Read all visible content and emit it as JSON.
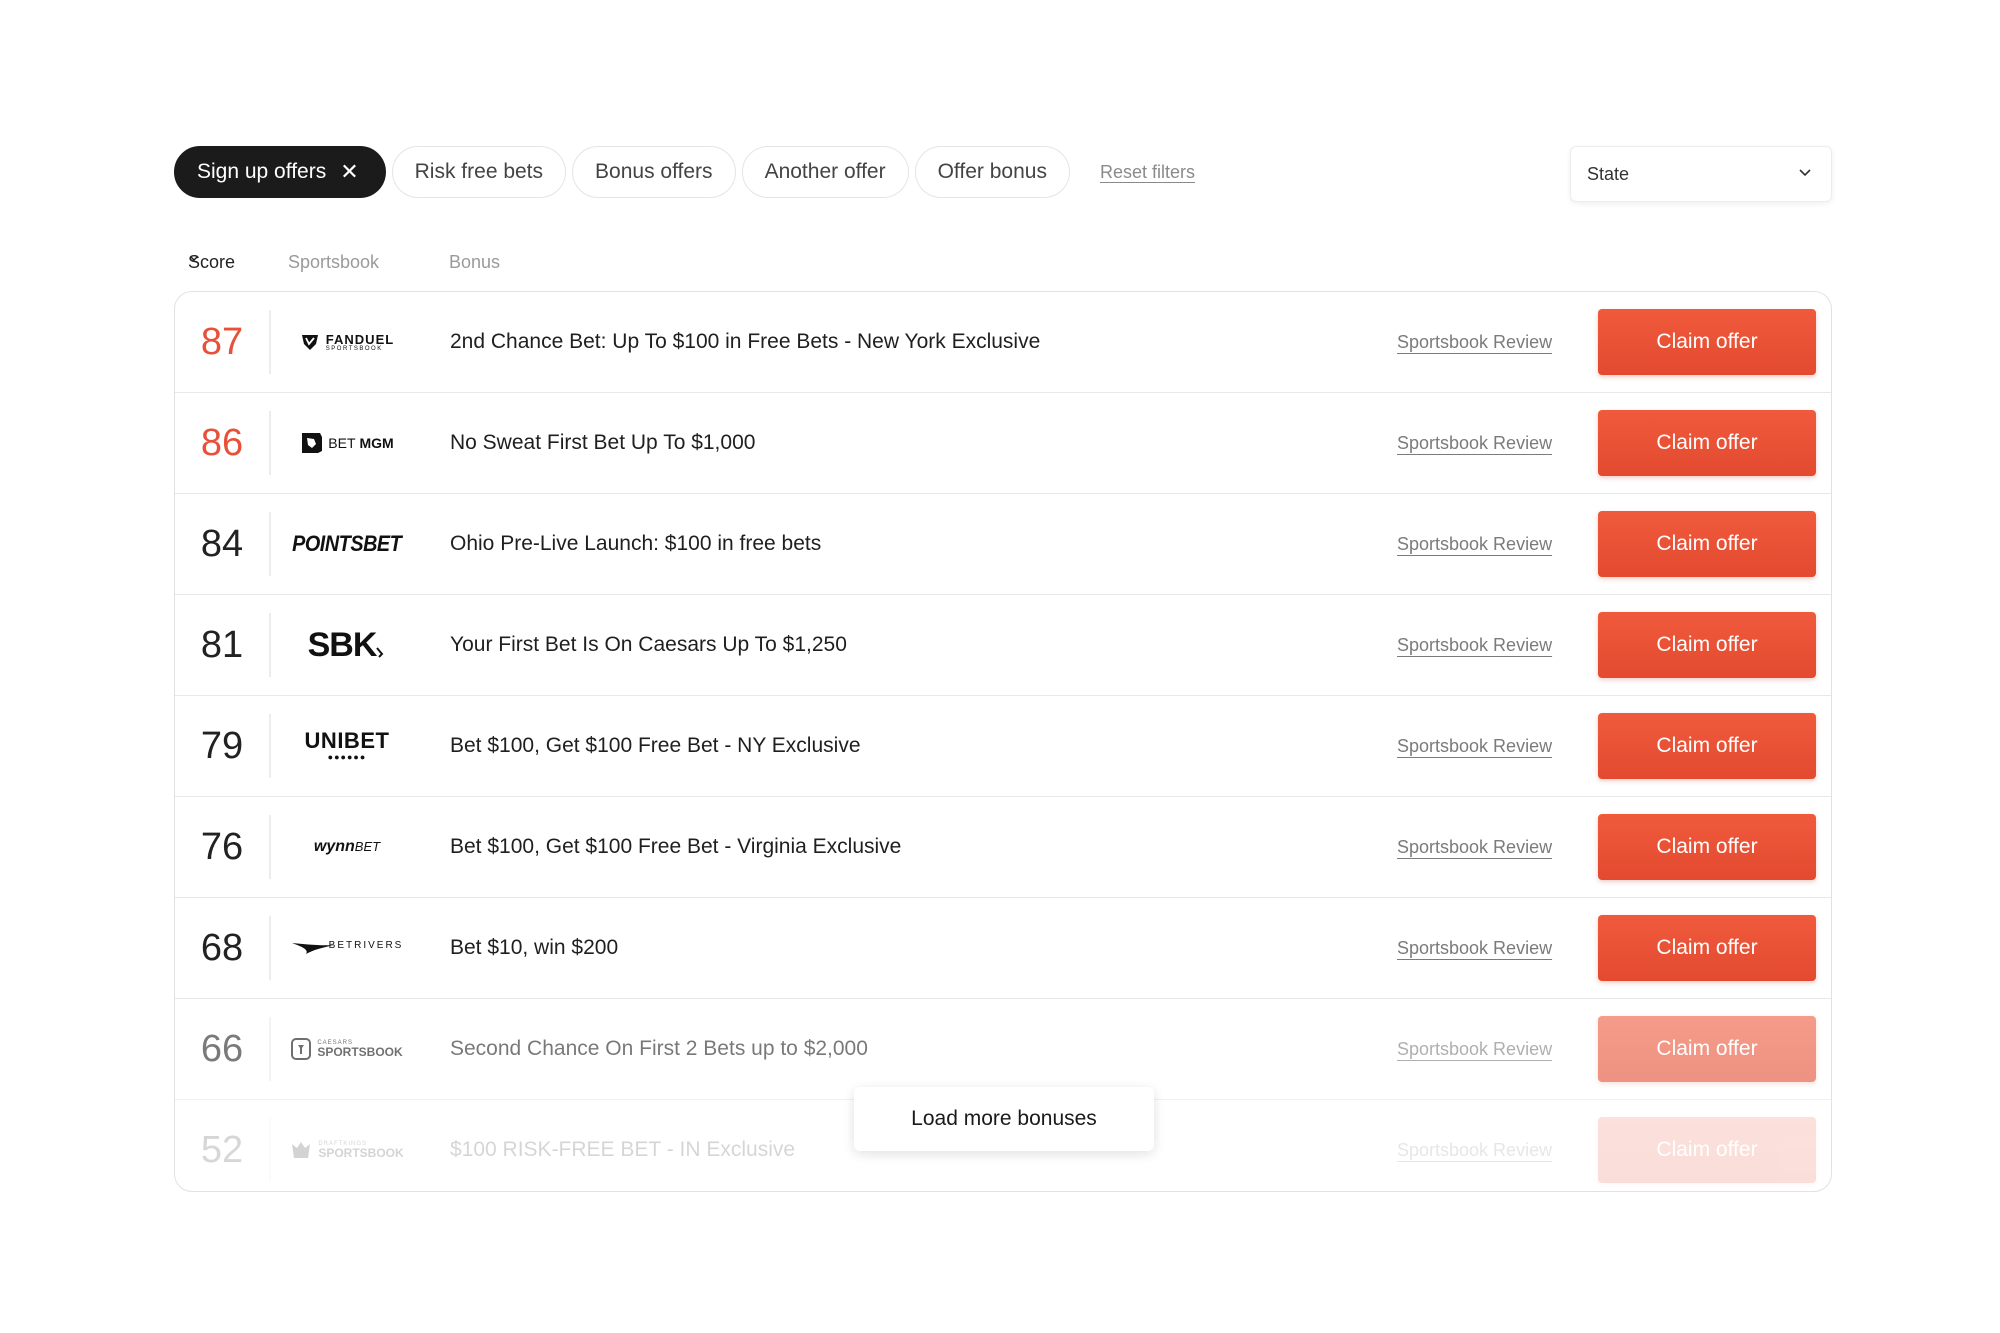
{
  "filters": {
    "chips": [
      {
        "label": "Sign up offers",
        "active": true
      },
      {
        "label": "Risk free bets",
        "active": false
      },
      {
        "label": "Bonus offers",
        "active": false
      },
      {
        "label": "Another offer",
        "active": false
      },
      {
        "label": "Offer bonus",
        "active": false
      }
    ],
    "reset_label": "Reset filters",
    "state_label": "State"
  },
  "columns": {
    "score": "Score",
    "sportsbook": "Sportsbook",
    "bonus": "Bonus"
  },
  "rows": [
    {
      "score": "87",
      "logo": "FANDUEL",
      "logo_sub": "SPORTSBOOK",
      "bonus": "2nd Chance Bet: Up To $100 in Free Bets - New York Exclusive",
      "review": "Sportsbook Review",
      "cta": "Claim offer"
    },
    {
      "score": "86",
      "logo": "BET",
      "logo_sub": "MGM",
      "bonus": "No Sweat First Bet Up To $1,000",
      "review": "Sportsbook Review",
      "cta": "Claim offer"
    },
    {
      "score": "84",
      "logo": "POINTSBET",
      "logo_sub": "",
      "bonus": "Ohio Pre-Live Launch: $100 in free bets",
      "review": "Sportsbook Review",
      "cta": "Claim offer"
    },
    {
      "score": "81",
      "logo": "SBK",
      "logo_sub": "",
      "bonus": "Your First Bet Is On Caesars Up To $1,250",
      "review": "Sportsbook Review",
      "cta": "Claim offer"
    },
    {
      "score": "79",
      "logo": "UNIBET",
      "logo_sub": "",
      "bonus": "Bet $100, Get $100 Free Bet - NY Exclusive",
      "review": "Sportsbook Review",
      "cta": "Claim offer"
    },
    {
      "score": "76",
      "logo": "wynn",
      "logo_sub": "BET",
      "bonus": "Bet $100, Get $100 Free Bet - Virginia Exclusive",
      "review": "Sportsbook Review",
      "cta": "Claim offer"
    },
    {
      "score": "68",
      "logo": "BETRIVERS",
      "logo_sub": "",
      "bonus": "Bet $10, win $200",
      "review": "Sportsbook Review",
      "cta": "Claim offer"
    },
    {
      "score": "66",
      "logo": "CAESARS",
      "logo_sub": "SPORTSBOOK",
      "bonus": "Second Chance On First 2 Bets up to $2,000",
      "review": "Sportsbook Review",
      "cta": "Claim offer"
    },
    {
      "score": "52",
      "logo": "DRAFTKINGS",
      "logo_sub": "SPORTSBOOK",
      "bonus": "$100 RISK-FREE BET - IN Exclusive",
      "review": "Sportsbook Review",
      "cta": "Claim offer"
    }
  ],
  "load_more_label": "Load more bonuses",
  "colors": {
    "accent": "#e8503a",
    "button": "#ec5436",
    "active_chip": "#1b1b1b"
  }
}
